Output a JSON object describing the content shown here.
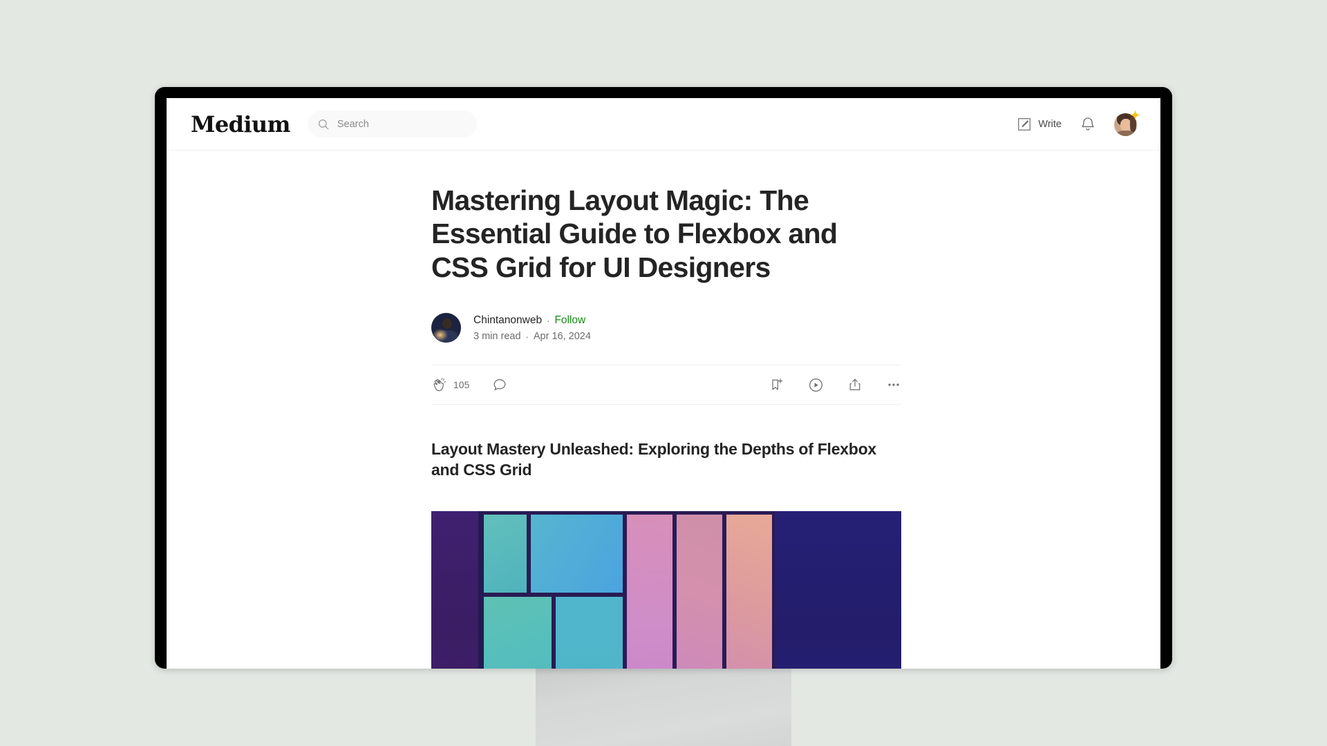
{
  "header": {
    "brand": "Medium",
    "search": {
      "placeholder": "Search",
      "value": "",
      "icon": "search-icon"
    },
    "write_label": "Write",
    "write_icon": "compose-pencil-icon",
    "bell_icon": "notification-bell-icon",
    "avatar_icon": "user-avatar",
    "avatar_badge_icon": "sparkle-star-icon"
  },
  "article": {
    "title": "Mastering Layout Magic: The Essential Guide to Flexbox and CSS Grid for UI Designers",
    "author": {
      "name": "Chintanonweb",
      "avatar_icon": "author-avatar",
      "follow_label": "Follow",
      "separator": "·"
    },
    "read_time": "3 min read",
    "date": "Apr 16, 2024",
    "engagement": {
      "clap_icon": "clap-icon",
      "clap_count": "105",
      "comment_icon": "comment-bubble-icon",
      "bookmark_icon": "bookmark-add-icon",
      "listen_icon": "play-circle-icon",
      "share_icon": "share-icon",
      "more_icon": "ellipsis-icon"
    },
    "subheading": "Layout Mastery Unleashed: Exploring the Depths of Flexbox and CSS Grid",
    "hero_image_alt": "grid-layout-illustration"
  },
  "colors": {
    "scene_background": "#e3e8e3",
    "bezel": "#000000",
    "screen": "#ffffff",
    "stand": "#d4d7d6",
    "text_primary": "#242424",
    "text_secondary": "#6b6b6b",
    "follow_green": "#1a8917",
    "search_background": "#f9f9f9",
    "hero_deep_purple": "#3a1f63",
    "hero_navy": "#221c63",
    "hero_teal": "#5bbcb8",
    "hero_blue": "#4aa8de",
    "hero_pink": "#d08bc4",
    "hero_salmon": "#e6a79a"
  }
}
